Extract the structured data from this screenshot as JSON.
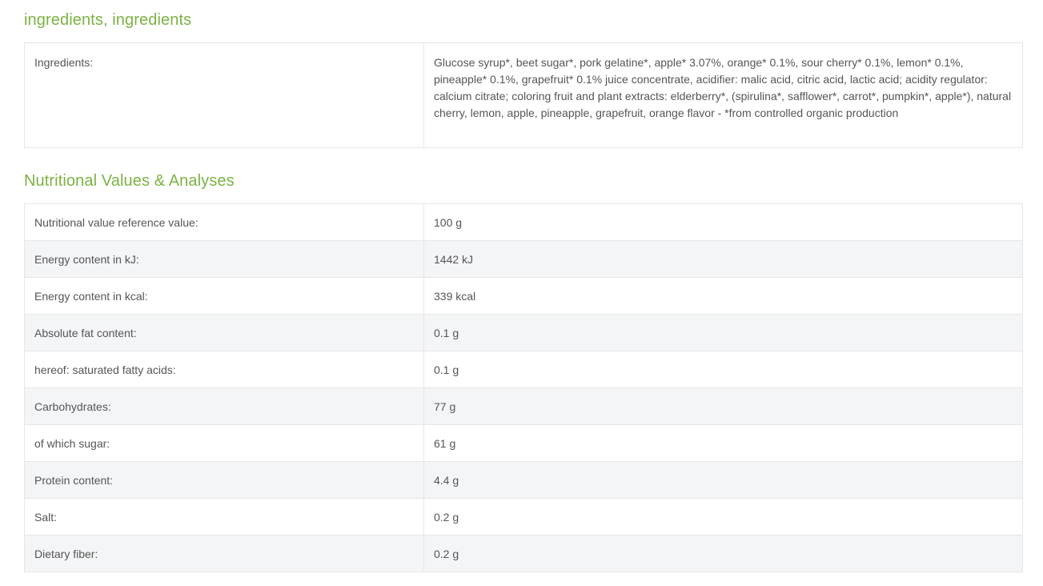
{
  "ingredients_section": {
    "title": "ingredients, ingredients",
    "label": "Ingredients:",
    "value": "Glucose syrup*, beet sugar*, pork gelatine*, apple* 3.07%, orange* 0.1%, sour cherry* 0.1%, lemon* 0.1%, pineapple* 0.1%, grapefruit* 0.1% juice concentrate, acidifier: malic acid, citric acid, lactic acid; acidity regulator: calcium citrate; coloring fruit and plant extracts: elderberry*, (spirulina*, safflower*, carrot*, pumpkin*, apple*), natural cherry, lemon, apple, pineapple, grapefruit, orange flavor - *from controlled organic production"
  },
  "nutrition_section": {
    "title": "Nutritional Values & Analyses",
    "rows": [
      {
        "label": "Nutritional value reference value:",
        "value": "100 g"
      },
      {
        "label": "Energy content in kJ:",
        "value": "1442 kJ"
      },
      {
        "label": "Energy content in kcal:",
        "value": "339 kcal"
      },
      {
        "label": "Absolute fat content:",
        "value": "0.1 g"
      },
      {
        "label": "hereof: saturated fatty acids:",
        "value": "0.1 g"
      },
      {
        "label": "Carbohydrates:",
        "value": "77 g"
      },
      {
        "label": "of which sugar:",
        "value": "61 g"
      },
      {
        "label": "Protein content:",
        "value": "4.4 g"
      },
      {
        "label": "Salt:",
        "value": "0.2 g"
      },
      {
        "label": "Dietary fiber:",
        "value": "0.2 g"
      }
    ]
  },
  "colors": {
    "heading": "#7cb342",
    "text": "#555555",
    "border": "#e6e6e6",
    "row_stripe": "#f4f5f7"
  }
}
